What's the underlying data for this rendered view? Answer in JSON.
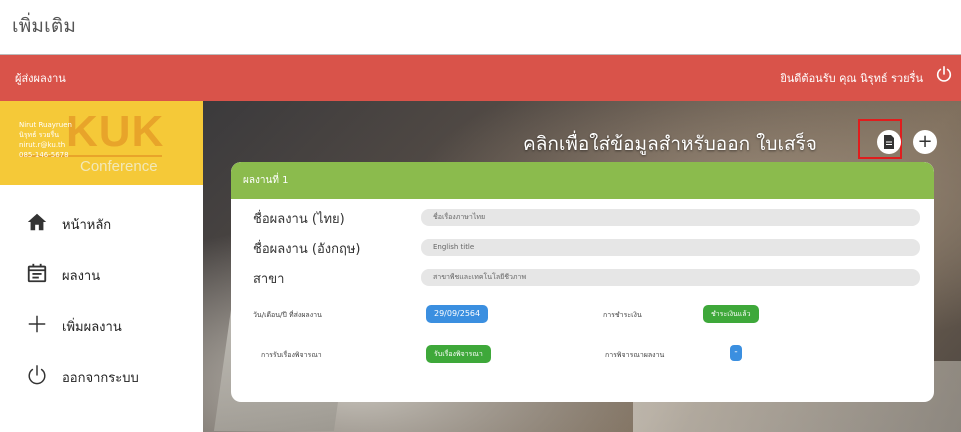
{
  "page": {
    "caption": "เพิ่มเติม"
  },
  "topbar": {
    "brand": "ผู้ส่งผลงาน",
    "welcome": "ยินดีต้อนรับ คุณ นิรุทธ์ รวยรื่น",
    "power_icon": "power-icon",
    "color": "#d9534a"
  },
  "logo": {
    "kuk": "KUK",
    "conference": "Conference",
    "user_lines": [
      "Nirut Ruayruen",
      "นิรุทธ์ รวยรื่น",
      "nirut.r@ku.th",
      "085-146-5678"
    ]
  },
  "nav": [
    {
      "label": "หน้าหลัก",
      "icon": "home-icon"
    },
    {
      "label": "ผลงาน",
      "icon": "calendar-icon"
    },
    {
      "label": "เพิ่มผลงาน",
      "icon": "plus-icon"
    },
    {
      "label": "ออกจากระบบ",
      "icon": "power-icon"
    }
  ],
  "hero": {
    "title": "คลิกเพื่อใส่ข้อมูลสำหรับออก ใบเสร็จ",
    "receipt_icon": "document-icon",
    "add_icon": "plus-icon",
    "add_label": "+"
  },
  "card": {
    "header": "ผลงานที่ 1",
    "header_color": "#8bbb4d",
    "rows": [
      {
        "label": "ชื่อผลงาน (ไทย)",
        "value": "ชื่อเรื่องภาษาไทย"
      },
      {
        "label": "ชื่อผลงาน (อังกฤษ)",
        "value": "English title"
      },
      {
        "label": "สาขา",
        "value": "สาขาพืชและเทคโนโลยีชีวภาพ"
      }
    ],
    "date_label": "วัน/เดือน/ปี ที่ส่งผลงาน",
    "date_value": "29/09/2564",
    "payment_label": "การชำระเงิน",
    "payment_status": "ชำระเงินแล้ว",
    "accept_label": "การรับเรื่องพิจารณา",
    "accept_status": "รับเรื่องพิจารณา",
    "review_label": "การพิจารณาผลงาน",
    "review_status": "-"
  }
}
